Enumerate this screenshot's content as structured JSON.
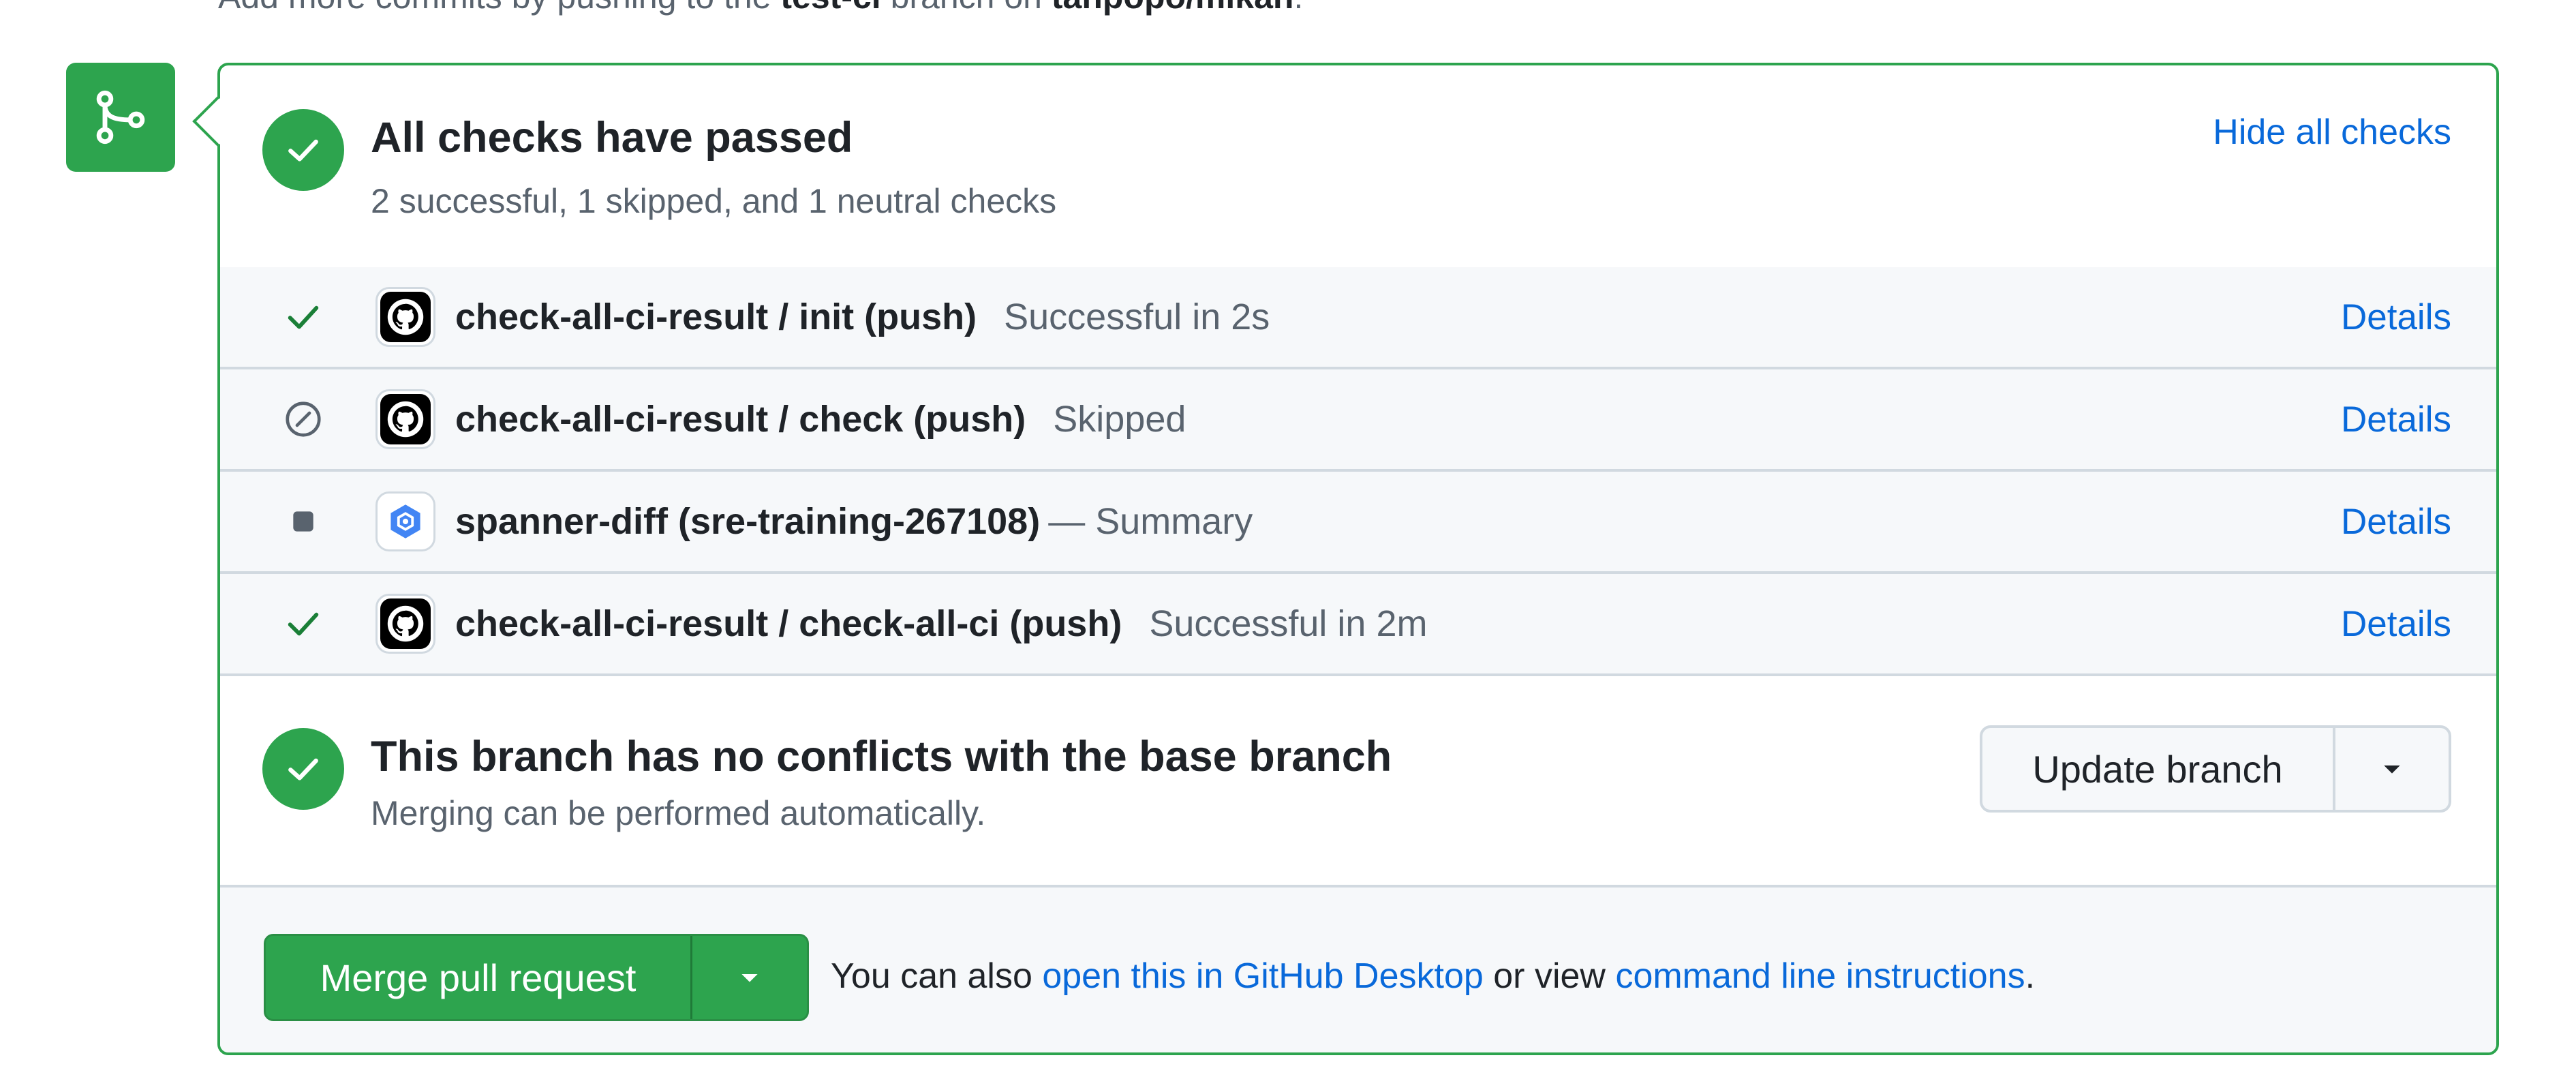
{
  "top_line": {
    "prefix": "Add more commits by pushing to the",
    "branch": "test-ci",
    "middle": "branch on",
    "repo": "tanpopo/mikan"
  },
  "checks": {
    "title": "All checks have passed",
    "subtitle": "2 successful, 1 skipped, and 1 neutral checks",
    "hide_label": "Hide all checks",
    "rows": [
      {
        "status": "success",
        "app_icon": "github-icon",
        "name": "check-all-ci-result / init (push)",
        "desc": "Successful in 2s",
        "details": "Details"
      },
      {
        "status": "skipped",
        "app_icon": "github-icon",
        "name": "check-all-ci-result / check (push)",
        "desc": "Skipped",
        "details": "Details"
      },
      {
        "status": "neutral",
        "app_icon": "cloud-build-icon",
        "name": "spanner-diff (sre-training-267108)",
        "desc": "— Summary",
        "details": "Details"
      },
      {
        "status": "success",
        "app_icon": "github-icon",
        "name": "check-all-ci-result / check-all-ci (push)",
        "desc": "Successful in 2m",
        "details": "Details"
      }
    ]
  },
  "conflict": {
    "title": "This branch has no conflicts with the base branch",
    "subtitle": "Merging can be performed automatically.",
    "update_label": "Update branch"
  },
  "merge": {
    "button_label": "Merge pull request",
    "also_prefix": "You can also",
    "desktop_link": "open this in GitHub Desktop",
    "or_view": "or view",
    "cli_link": "command line instructions",
    "suffix": "."
  },
  "colors": {
    "success": "#2da44e",
    "link": "#0969da",
    "muted": "#59636e",
    "border": "#d1d9e0"
  }
}
